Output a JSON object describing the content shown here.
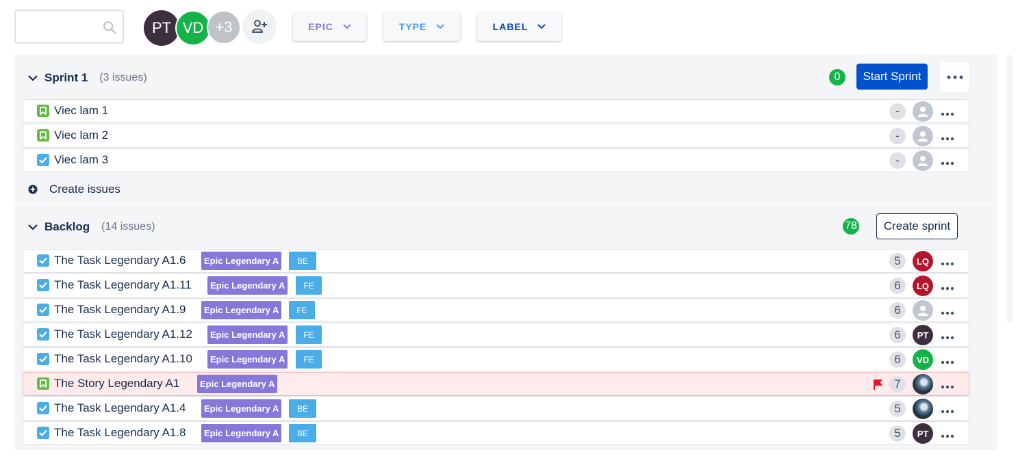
{
  "toolbar": {
    "search": {
      "placeholder": ""
    },
    "members": [
      {
        "initials": "PT",
        "color": "#3e2f3f"
      },
      {
        "initials": "VD",
        "color": "#13b34a"
      }
    ],
    "more_members": "+3",
    "filters": [
      {
        "label": "EPIC",
        "color": "#8777d9"
      },
      {
        "label": "TYPE",
        "color": "#4c9aff"
      },
      {
        "label": "LABEL",
        "color": "#0747a6"
      }
    ]
  },
  "sprint": {
    "title": "Sprint 1",
    "count_text": "(3 issues)",
    "points_total": "0",
    "start_button": "Start Sprint",
    "issues": [
      {
        "type": "story",
        "summary": "Viec lam 1",
        "points": "-",
        "assignee": ""
      },
      {
        "type": "story",
        "summary": "Viec lam 2",
        "points": "-",
        "assignee": ""
      },
      {
        "type": "task",
        "summary": "Viec lam 3",
        "points": "-",
        "assignee": ""
      }
    ],
    "create_issues": "Create issues"
  },
  "backlog": {
    "title": "Backlog",
    "count_text": "(14 issues)",
    "points_total": "78",
    "create_sprint_button": "Create sprint",
    "issues": [
      {
        "type": "task",
        "summary": "The Task Legendary A1.6",
        "epic": "Epic Legendary A",
        "label": "BE",
        "points": "5",
        "assignee": "LQ",
        "flagged": false
      },
      {
        "type": "task",
        "summary": "The Task Legendary A1.11",
        "epic": "Epic Legendary A",
        "label": "FE",
        "points": "6",
        "assignee": "LQ",
        "flagged": false
      },
      {
        "type": "task",
        "summary": "The Task Legendary A1.9",
        "epic": "Epic Legendary A",
        "label": "FE",
        "points": "6",
        "assignee": "",
        "flagged": false
      },
      {
        "type": "task",
        "summary": "The Task Legendary A1.12",
        "epic": "Epic Legendary A",
        "label": "FE",
        "points": "6",
        "assignee": "PT",
        "flagged": false
      },
      {
        "type": "task",
        "summary": "The Task Legendary A1.10",
        "epic": "Epic Legendary A",
        "label": "FE",
        "points": "6",
        "assignee": "VD",
        "flagged": false
      },
      {
        "type": "story",
        "summary": "The Story Legendary A1",
        "epic": "Epic Legendary A",
        "label": "",
        "points": "7",
        "assignee": "photo",
        "flagged": true
      },
      {
        "type": "task",
        "summary": "The Task Legendary A1.4",
        "epic": "Epic Legendary A",
        "label": "BE",
        "points": "5",
        "assignee": "photo",
        "flagged": false
      },
      {
        "type": "task",
        "summary": "The Task Legendary A1.8",
        "epic": "Epic Legendary A",
        "label": "BE",
        "points": "5",
        "assignee": "PT",
        "flagged": false
      }
    ]
  },
  "colors": {
    "primary": "#0052cc",
    "success": "#13b34a",
    "epic": "#8777d9",
    "label": "#4bade8",
    "story": "#65ba43",
    "flag": "#e5162c"
  }
}
